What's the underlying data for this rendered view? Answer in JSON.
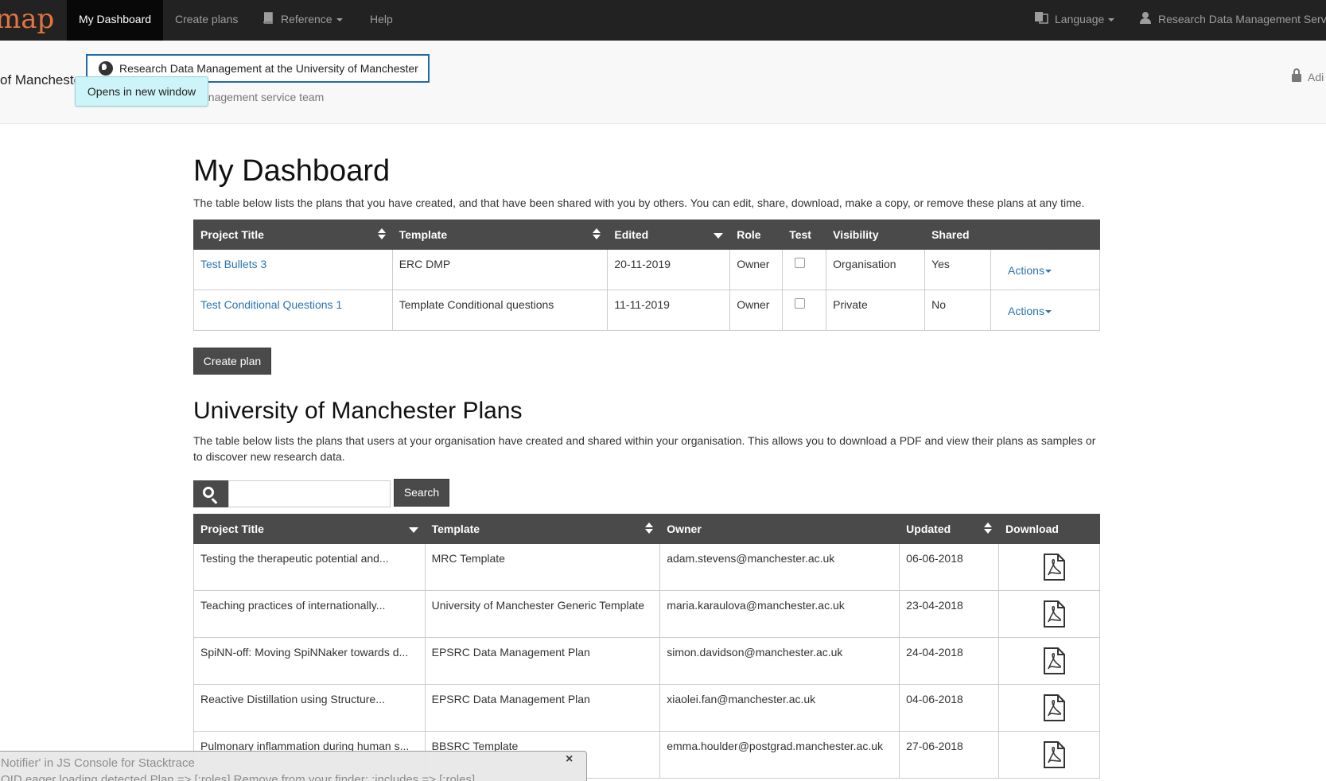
{
  "navbar": {
    "brand": "map",
    "items": [
      {
        "label": "My Dashboard",
        "active": true
      },
      {
        "label": "Create plans"
      },
      {
        "label": "Reference"
      },
      {
        "label": "Help"
      }
    ],
    "language": "Language",
    "user": "Research Data Management Serv"
  },
  "org_header": {
    "name": "of Mancheste",
    "link_text": "Research Data Management at the University of Manchester",
    "tooltip": "Opens in new window",
    "subtitle": "anagement service team",
    "admin": "Adi"
  },
  "dashboard": {
    "title": "My Dashboard",
    "description": "The table below lists the plans that you have created, and that have been shared with you by others. You can edit, share, download, make a copy, or remove these plans at any time.",
    "columns": [
      "Project Title",
      "Template",
      "Edited",
      "Role",
      "Test",
      "Visibility",
      "Shared",
      ""
    ],
    "rows": [
      {
        "title": "Test Bullets 3",
        "template": "ERC DMP",
        "edited": "20-11-2019",
        "role": "Owner",
        "test": false,
        "visibility": "Organisation",
        "shared": "Yes",
        "actions": "Actions"
      },
      {
        "title": "Test Conditional Questions 1",
        "template": "Template Conditional questions",
        "edited": "11-11-2019",
        "role": "Owner",
        "test": false,
        "visibility": "Private",
        "shared": "No",
        "actions": "Actions"
      }
    ],
    "create_button": "Create plan"
  },
  "org_plans": {
    "title": "University of Manchester Plans",
    "description": "The table below lists the plans that users at your organisation have created and shared within your organisation. This allows you to download a PDF and view their plans as samples or to discover new research data.",
    "search_button": "Search",
    "search_placeholder": "",
    "columns": [
      "Project Title",
      "Template",
      "Owner",
      "Updated",
      "Download"
    ],
    "rows": [
      {
        "title": "Testing the therapeutic potential and...",
        "template": "MRC Template",
        "owner": "adam.stevens@manchester.ac.uk",
        "updated": "06-06-2018"
      },
      {
        "title": "Teaching practices of internationally...",
        "template": "University of Manchester Generic Template",
        "owner": "maria.karaulova@manchester.ac.uk",
        "updated": "23-04-2018"
      },
      {
        "title": "SpiNN-off: Moving SpiNNaker towards d...",
        "template": "EPSRC Data Management Plan",
        "owner": "simon.davidson@manchester.ac.uk",
        "updated": "24-04-2018"
      },
      {
        "title": "Reactive Distillation using Structure...",
        "template": "EPSRC Data Management Plan",
        "owner": "xiaolei.fan@manchester.ac.uk",
        "updated": "04-06-2018"
      },
      {
        "title": "Pulmonary inflammation during human s...",
        "template": "BBSRC Template",
        "owner": "emma.houlder@postgrad.manchester.ac.uk",
        "updated": "27-06-2018"
      }
    ]
  },
  "notifier": {
    "line1": "Notifier' in JS Console for Stacktrace",
    "line2": "OID eager loading detected Plan => [:roles] Remove from your finder: :includes => [:roles]",
    "close": "×"
  }
}
